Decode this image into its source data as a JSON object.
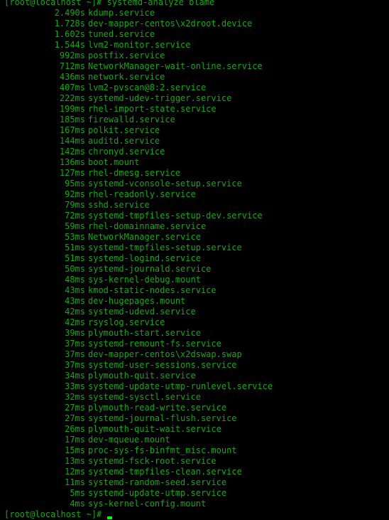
{
  "terminal": {
    "prompt": "[root@localhost ~]# ",
    "command": "systemd-analyze blame",
    "text_color": "#12a812",
    "cursor_color": "#00ff00",
    "final_prompt": "[root@localhost ~]# ",
    "rows": [
      {
        "time": "2.490s",
        "unit": "kdump.service"
      },
      {
        "time": "1.728s",
        "unit": "dev-mapper-centos\\x2droot.device"
      },
      {
        "time": "1.602s",
        "unit": "tuned.service"
      },
      {
        "time": "1.544s",
        "unit": "lvm2-monitor.service"
      },
      {
        "time": "992ms",
        "unit": "postfix.service"
      },
      {
        "time": "712ms",
        "unit": "NetworkManager-wait-online.service"
      },
      {
        "time": "436ms",
        "unit": "network.service"
      },
      {
        "time": "407ms",
        "unit": "lvm2-pvscan@8:2.service"
      },
      {
        "time": "222ms",
        "unit": "systemd-udev-trigger.service"
      },
      {
        "time": "199ms",
        "unit": "rhel-import-state.service"
      },
      {
        "time": "185ms",
        "unit": "firewalld.service"
      },
      {
        "time": "167ms",
        "unit": "polkit.service"
      },
      {
        "time": "144ms",
        "unit": "auditd.service"
      },
      {
        "time": "142ms",
        "unit": "chronyd.service"
      },
      {
        "time": "136ms",
        "unit": "boot.mount"
      },
      {
        "time": "127ms",
        "unit": "rhel-dmesg.service"
      },
      {
        "time": "95ms",
        "unit": "systemd-vconsole-setup.service"
      },
      {
        "time": "92ms",
        "unit": "rhel-readonly.service"
      },
      {
        "time": "79ms",
        "unit": "sshd.service"
      },
      {
        "time": "72ms",
        "unit": "systemd-tmpfiles-setup-dev.service"
      },
      {
        "time": "59ms",
        "unit": "rhel-domainname.service"
      },
      {
        "time": "53ms",
        "unit": "NetworkManager.service"
      },
      {
        "time": "51ms",
        "unit": "systemd-tmpfiles-setup.service"
      },
      {
        "time": "51ms",
        "unit": "systemd-logind.service"
      },
      {
        "time": "50ms",
        "unit": "systemd-journald.service"
      },
      {
        "time": "48ms",
        "unit": "sys-kernel-debug.mount"
      },
      {
        "time": "43ms",
        "unit": "kmod-static-nodes.service"
      },
      {
        "time": "43ms",
        "unit": "dev-hugepages.mount"
      },
      {
        "time": "42ms",
        "unit": "systemd-udevd.service"
      },
      {
        "time": "42ms",
        "unit": "rsyslog.service"
      },
      {
        "time": "39ms",
        "unit": "plymouth-start.service"
      },
      {
        "time": "37ms",
        "unit": "systemd-remount-fs.service"
      },
      {
        "time": "37ms",
        "unit": "dev-mapper-centos\\x2dswap.swap"
      },
      {
        "time": "37ms",
        "unit": "systemd-user-sessions.service"
      },
      {
        "time": "34ms",
        "unit": "plymouth-quit.service"
      },
      {
        "time": "33ms",
        "unit": "systemd-update-utmp-runlevel.service"
      },
      {
        "time": "32ms",
        "unit": "systemd-sysctl.service"
      },
      {
        "time": "27ms",
        "unit": "plymouth-read-write.service"
      },
      {
        "time": "27ms",
        "unit": "systemd-journal-flush.service"
      },
      {
        "time": "26ms",
        "unit": "plymouth-quit-wait.service"
      },
      {
        "time": "17ms",
        "unit": "dev-mqueue.mount"
      },
      {
        "time": "15ms",
        "unit": "proc-sys-fs-binfmt_misc.mount"
      },
      {
        "time": "13ms",
        "unit": "systemd-fsck-root.service"
      },
      {
        "time": "12ms",
        "unit": "systemd-tmpfiles-clean.service"
      },
      {
        "time": "11ms",
        "unit": "systemd-random-seed.service"
      },
      {
        "time": "5ms",
        "unit": "systemd-update-utmp.service"
      },
      {
        "time": "4ms",
        "unit": "sys-kernel-config.mount"
      }
    ]
  }
}
